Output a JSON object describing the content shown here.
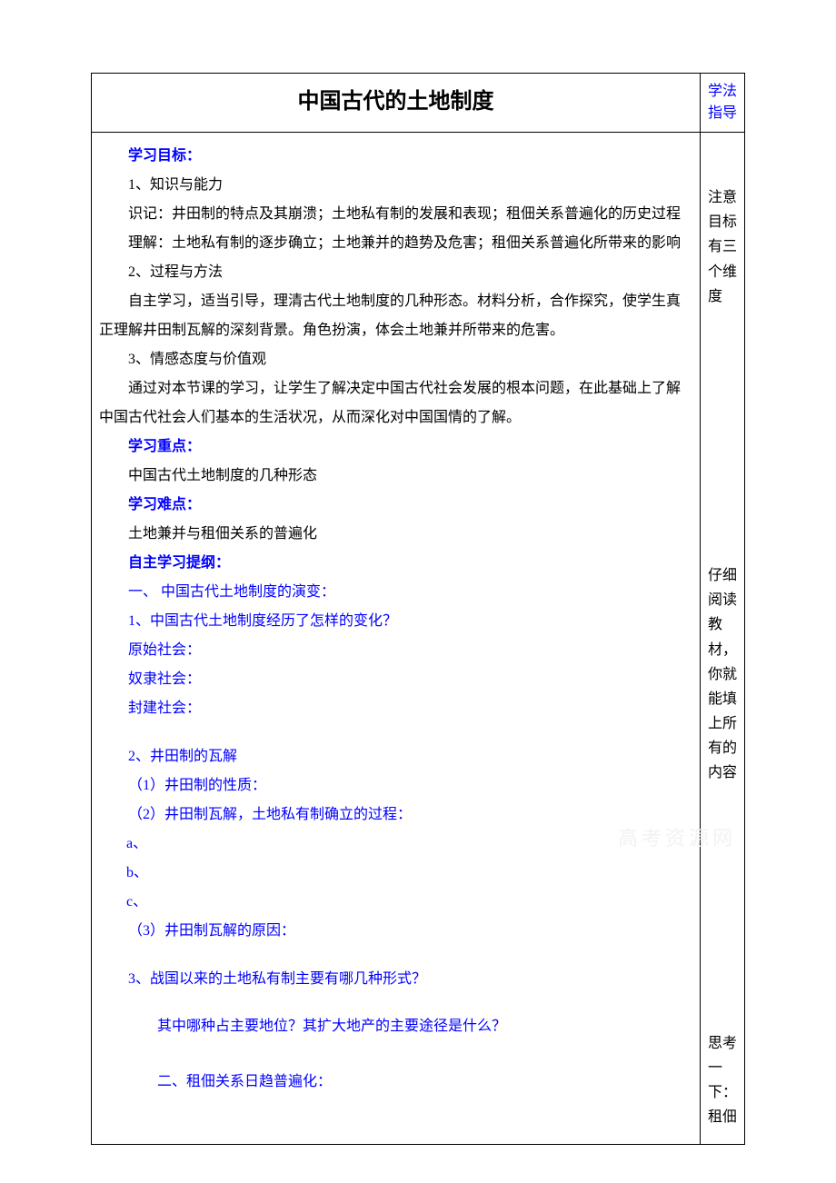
{
  "title": "中国古代的土地制度",
  "guideHeader": "学法指导",
  "guideNotes": {
    "n1": "注意目标有三个维度",
    "n2": "仔细阅读教材，你就能填上所有的内容",
    "n3": "思考一下：租佃"
  },
  "headings": {
    "objectives": "学习目标：",
    "keypoint": "学习重点：",
    "difficulty": "学习难点：",
    "selfstudy": "自主学习提纲："
  },
  "objectives": {
    "k_title": "1、知识与能力",
    "k_memo": "识记：井田制的特点及其崩溃；土地私有制的发展和表现；租佃关系普遍化的历史过程",
    "k_understand": "理解：土地私有制的逐步确立；土地兼并的趋势及危害；租佃关系普遍化所带来的影响",
    "p_title": "2、过程与方法",
    "p_body": "自主学习，适当引导，理清古代土地制度的几种形态。材料分析，合作探究，使学生真正理解井田制瓦解的深刻背景。角色扮演，体会土地兼并所带来的危害。",
    "a_title": "3、情感态度与价值观",
    "a_body": "通过对本节课的学习，让学生了解决定中国古代社会发展的根本问题，在此基础上了解中国古代社会人们基本的生活状况，从而深化对中国国情的了解。"
  },
  "keypoint_body": "中国古代土地制度的几种形态",
  "difficulty_body": "土地兼并与租佃关系的普遍化",
  "selfstudy": {
    "sec1_title": "一、 中国古代土地制度的演变：",
    "q1": "1、中国古代土地制度经历了怎样的变化？",
    "primitive": "原始社会：",
    "slave": "奴隶社会：",
    "feudal": "封建社会：",
    "q2": "2、井田制的瓦解",
    "q2_1": "（1）井田制的性质：",
    "q2_2": "（2）井田制瓦解，土地私有制确立的过程：",
    "a": "a、",
    "b": "b、",
    "c": "c、",
    "q2_3": "（3）井田制瓦解的原因：",
    "q3": "3、战国以来的土地私有制主要有哪几种形式？",
    "q3b": "其中哪种占主要地位？其扩大地产的主要途径是什么？",
    "sec2_title": "二、租佃关系日趋普遍化："
  },
  "watermark": "高考资源网"
}
